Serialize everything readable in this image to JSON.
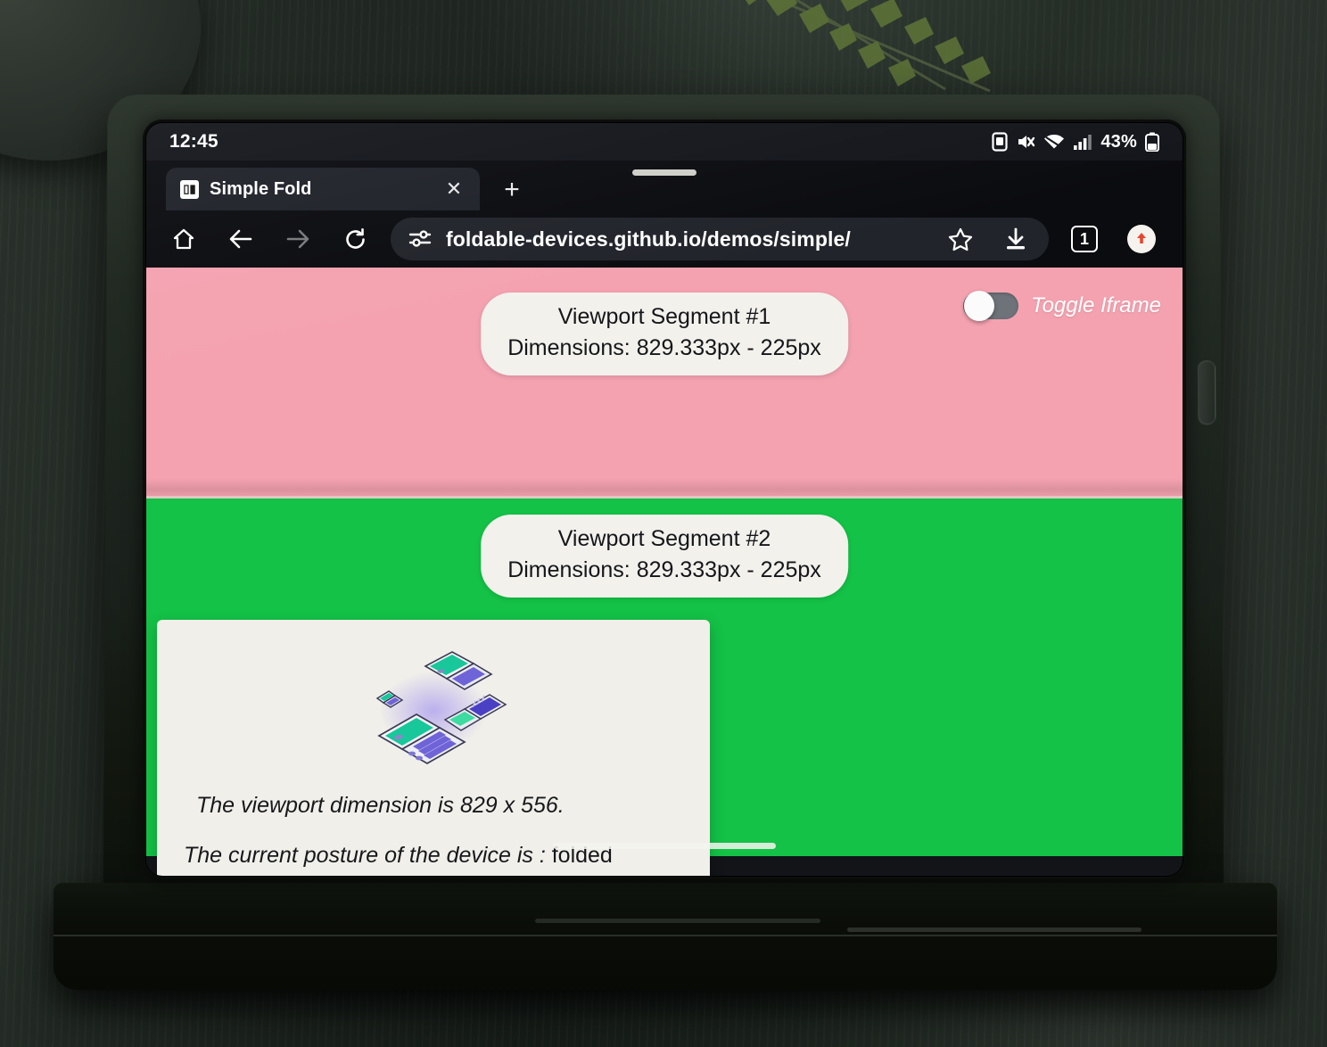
{
  "status_bar": {
    "clock": "12:45",
    "battery_percent": "43%",
    "icons": [
      "screenshot-icon",
      "mute-icon",
      "wifi-icon",
      "signal-icon",
      "battery-icon"
    ]
  },
  "browser": {
    "tab": {
      "title": "Simple Fold",
      "favicon_glyph": "▯▮",
      "close_glyph": "✕"
    },
    "new_tab_glyph": "+",
    "toolbar": {
      "home_icon": "home-icon",
      "back_icon": "back-arrow-icon",
      "forward_icon": "forward-arrow-icon",
      "reload_icon": "reload-icon",
      "site_settings_icon": "tune-icon",
      "bookmark_icon": "star-icon",
      "download_icon": "download-icon",
      "tab_count": "1",
      "profile_icon": "profile-icon"
    },
    "url": "foldable-devices.github.io/demos/simple/"
  },
  "page": {
    "segment_1": {
      "title": "Viewport Segment #1",
      "dimensions": "Dimensions: 829.333px - 225px",
      "color": "#f4a2b0"
    },
    "segment_2": {
      "title": "Viewport Segment #2",
      "dimensions": "Dimensions: 829.333px - 225px",
      "color": "#14c247"
    },
    "toggle": {
      "label": "Toggle Iframe",
      "state": "off"
    },
    "info_card": {
      "illustration": "foldable-devices-illustration",
      "viewport_line": "The viewport dimension is 829 x 556.",
      "posture_prefix": "The current posture of the device is : ",
      "posture_value": "folded"
    }
  }
}
